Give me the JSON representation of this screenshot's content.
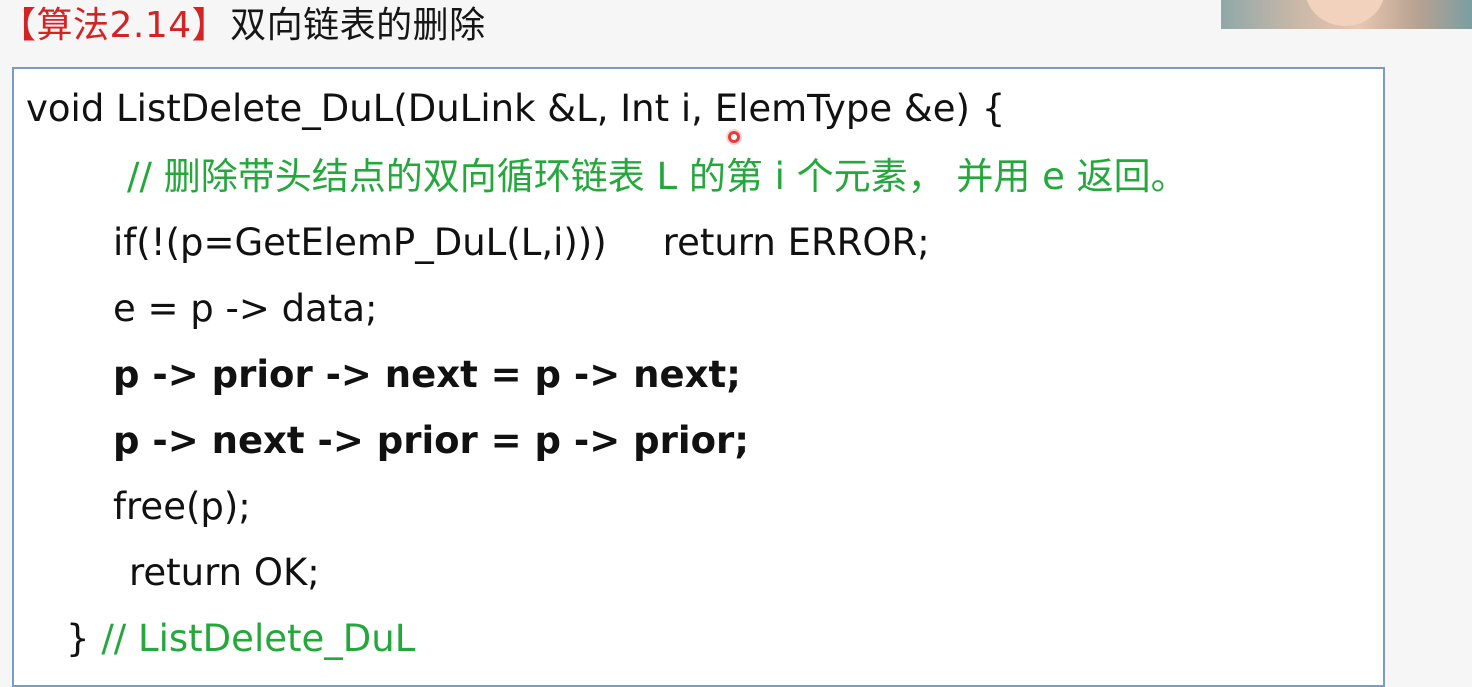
{
  "title": {
    "tag": "【算法2.14】",
    "text": "双向链表的删除"
  },
  "code": {
    "line1": "void ListDelete_DuL(DuLink &L, Int i, ElemType &e) {",
    "comment": "// 删除带头结点的双向循环链表 L 的第 i 个元素， 并用 e 返回。",
    "line3_condition": "if(!(p=GetElemP_DuL(L,i)))",
    "line3_return": "return ERROR;",
    "line4": "e = p -> data;",
    "line5": "p -> prior -> next = p -> next;",
    "line6": "p -> next -> prior = p -> prior;",
    "line7": "free(p);",
    "line8": "return OK;",
    "line9_brace": "}",
    "line9_comment": "// ListDelete_DuL"
  },
  "colors": {
    "title_tag": "#d32323",
    "comment": "#24a83c",
    "box_border": "#7a9bc8",
    "cursor": "#e43b3b"
  },
  "icons": {
    "cursor": "cursor-dot",
    "webcam": "presenter-webcam"
  }
}
